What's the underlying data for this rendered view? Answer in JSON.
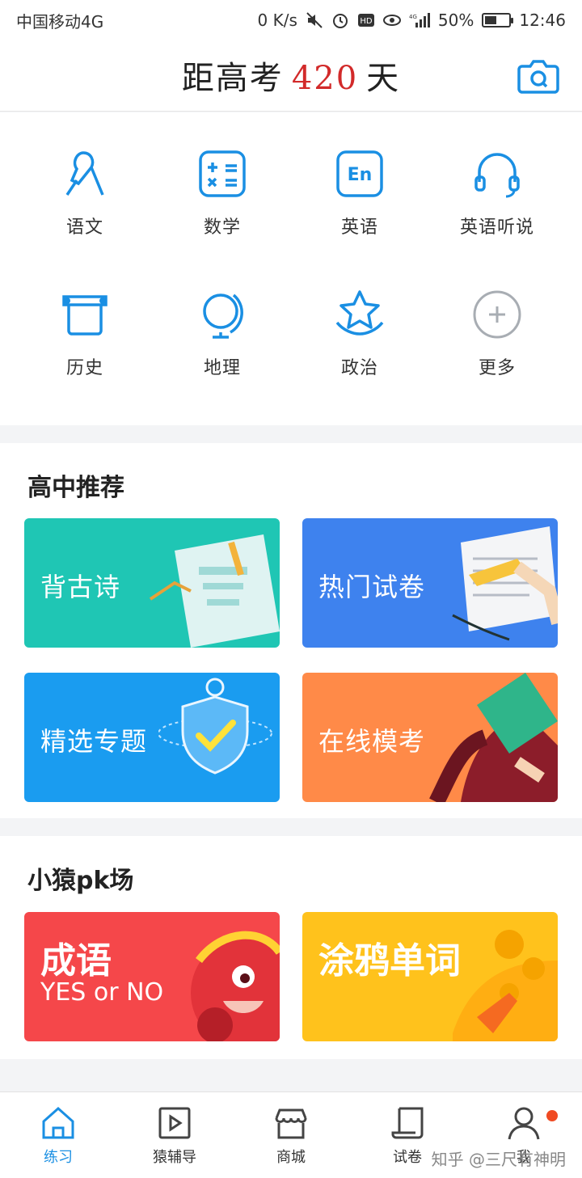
{
  "status": {
    "carrier": "中国移动4G",
    "speed": "0 K/s",
    "battery": "50%",
    "battery_level": 0.5,
    "time": "12:46"
  },
  "header": {
    "title_prefix": "距高考",
    "days": "420",
    "title_suffix": "天"
  },
  "subjects": [
    {
      "label": "语文",
      "icon": "chinese-icon"
    },
    {
      "label": "数学",
      "icon": "math-icon"
    },
    {
      "label": "英语",
      "icon": "english-icon"
    },
    {
      "label": "英语听说",
      "icon": "headphones-icon"
    },
    {
      "label": "历史",
      "icon": "history-icon"
    },
    {
      "label": "地理",
      "icon": "globe-icon"
    },
    {
      "label": "政治",
      "icon": "star-icon"
    },
    {
      "label": "更多",
      "icon": "plus-icon"
    }
  ],
  "recommend": {
    "title": "高中推荐",
    "cards": [
      {
        "label": "背古诗",
        "color": "#1fc6b4"
      },
      {
        "label": "热门试卷",
        "color": "#3e82ee"
      },
      {
        "label": "精选专题",
        "color": "#1a9cf0"
      },
      {
        "label": "在线模考",
        "color": "#ff8a48"
      }
    ]
  },
  "pk": {
    "title": "小猿pk场",
    "cards": [
      {
        "big": "成语",
        "small": "YES or NO",
        "color": "#f5474a"
      },
      {
        "big": "涂鸦单词",
        "small": "",
        "color": "#ffc21c"
      }
    ]
  },
  "nav": [
    {
      "label": "练习",
      "icon": "home-icon",
      "active": true
    },
    {
      "label": "猿辅导",
      "icon": "play-icon",
      "active": false
    },
    {
      "label": "商城",
      "icon": "shop-icon",
      "active": false
    },
    {
      "label": "试卷",
      "icon": "scroll-icon",
      "active": false
    },
    {
      "label": "我",
      "icon": "user-icon",
      "active": false
    }
  ],
  "watermark": "知乎 @三尺有神明",
  "colors": {
    "accent": "#1a8fe3",
    "red": "#d22a2a"
  }
}
